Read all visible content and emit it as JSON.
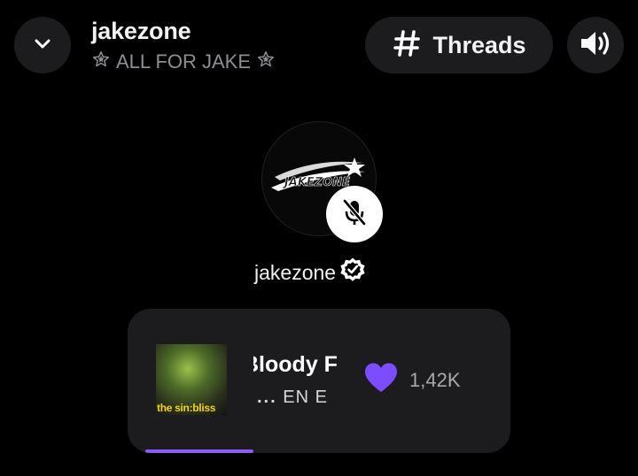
{
  "header": {
    "title": "jakezone",
    "subtitle": "ALL FOR JAKE",
    "threads_label": "Threads"
  },
  "host": {
    "name": "jakezone",
    "avatar_logo": "JAKEZONE",
    "verified": true,
    "muted": true
  },
  "now_playing": {
    "title_visible": "Bloody F",
    "artist_visible": "EN E",
    "album_text": "the sin:bliss",
    "likes": "1,42K",
    "heart_color": "#7c4dff",
    "progress": 0.31
  },
  "icons": {
    "back": "chevron-down-icon",
    "threads": "hash-icon",
    "sound": "speaker-icon",
    "mute": "mic-off-icon",
    "verified": "verified-badge-icon",
    "like": "heart-icon"
  },
  "colors": {
    "background": "#000000",
    "surface": "#1c1c1e",
    "accent": "#8b5cf6"
  }
}
